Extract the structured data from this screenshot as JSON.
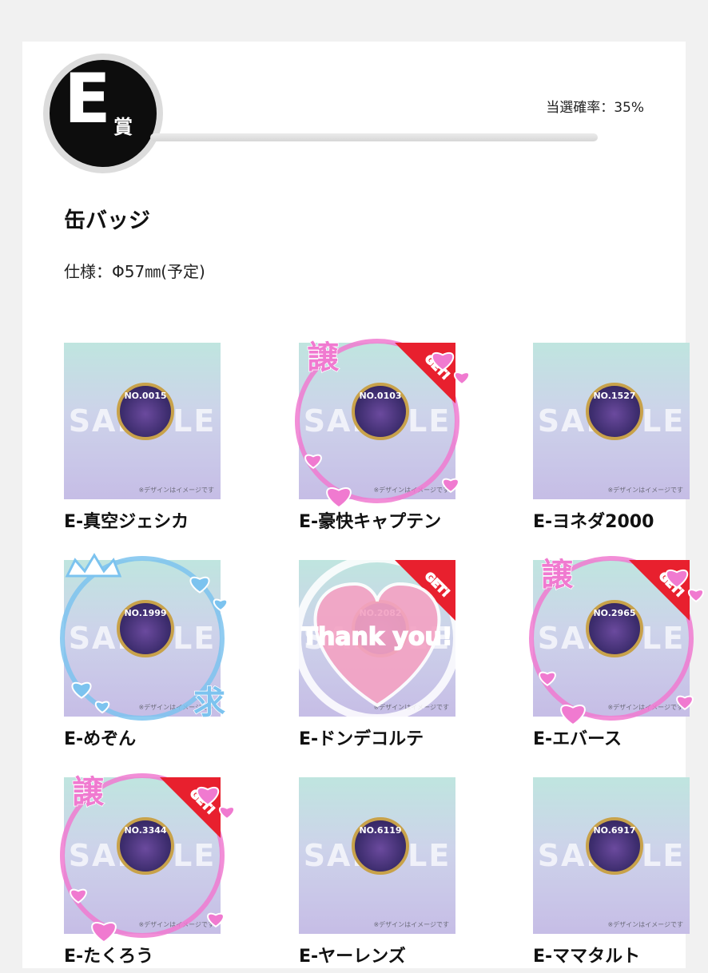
{
  "prize": {
    "letter": "E",
    "suffix": "賞",
    "rate_label": "当選確率：35%"
  },
  "product": {
    "title": "缶バッジ",
    "spec": "仕様：Φ57㎜(予定)"
  },
  "watermark": "SAMPLE",
  "design_note": "※デザインはイメージです",
  "overlay_texts": {
    "yuzuru": "譲",
    "motomu": "求",
    "get": "GET!",
    "thank_you": "Thank you!"
  },
  "items": [
    {
      "label": "E-真空ジェシカ",
      "number": "NO.0015",
      "overlay": "none"
    },
    {
      "label": "E-豪快キャプテン",
      "number": "NO.0103",
      "overlay": "yuzuru"
    },
    {
      "label": "E-ヨネダ2000",
      "number": "NO.1527",
      "overlay": "none"
    },
    {
      "label": "E-めぞん",
      "number": "NO.1999",
      "overlay": "motomu"
    },
    {
      "label": "E-ドンデコルテ",
      "number": "NO.2082",
      "overlay": "thankyou"
    },
    {
      "label": "E-エバース",
      "number": "NO.2965",
      "overlay": "yuzuru"
    },
    {
      "label": "E-たくろう",
      "number": "NO.3344",
      "overlay": "yuzuru"
    },
    {
      "label": "E-ヤーレンズ",
      "number": "NO.6119",
      "overlay": "none"
    },
    {
      "label": "E-ママタルト",
      "number": "NO.6917",
      "overlay": "none"
    }
  ],
  "colors": {
    "badge_black": "#0d0d0d",
    "overlay_pink": "#f07ad0",
    "overlay_blue": "#7cc3ef",
    "get_red": "#e8202e"
  }
}
